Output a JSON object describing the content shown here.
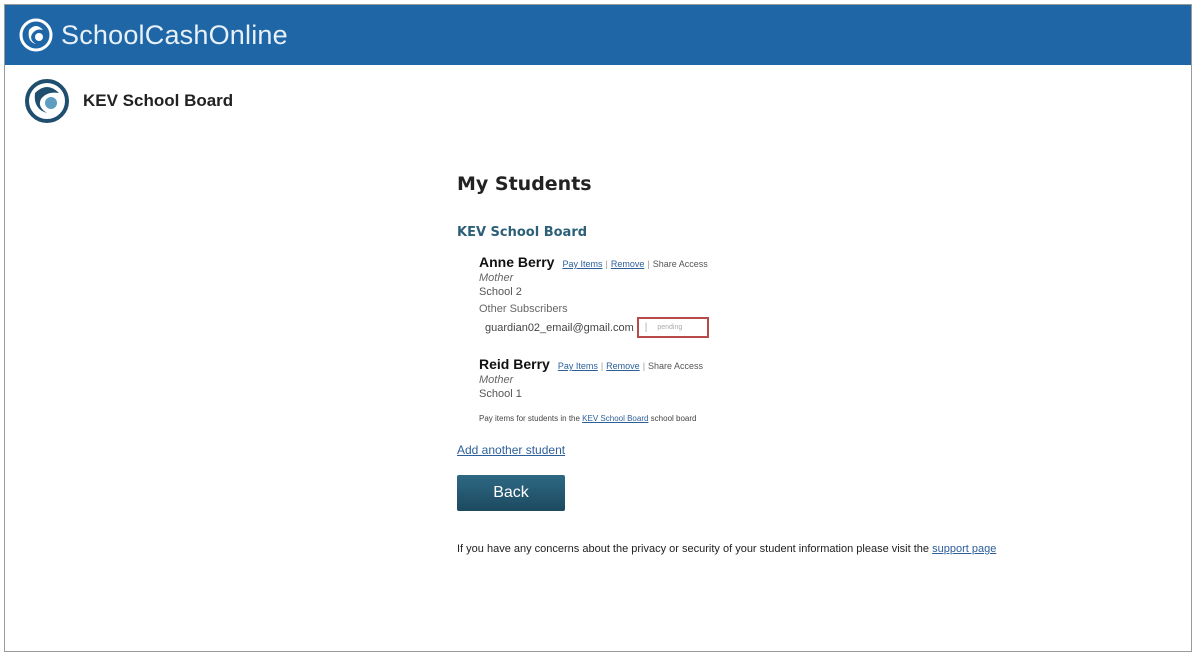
{
  "topbar": {
    "brand": "SchoolCashOnline",
    "bg_color": "#1f66a6"
  },
  "board_header": {
    "name": "KEV School Board"
  },
  "main": {
    "title": "My Students",
    "school_board": "KEV School Board",
    "students": [
      {
        "name": "Anne Berry",
        "actions": {
          "pay_items": "Pay Items",
          "remove": "Remove",
          "share": "Share Access"
        },
        "relation": "Mother",
        "school": "School 2",
        "other_subscribers_label": "Other Subscribers",
        "subscriber_email": "guardian02_email@gmail.com",
        "subscriber_status": "pending"
      },
      {
        "name": "Reid Berry",
        "actions": {
          "pay_items": "Pay Items",
          "remove": "Remove",
          "share": "Share Access"
        },
        "relation": "Mother",
        "school": "School 1"
      }
    ],
    "board_note": {
      "prefix": "Pay items for students in the",
      "link": "KEV School Board",
      "suffix": "school board"
    },
    "add_student": "Add another student",
    "back_button": "Back",
    "privacy": {
      "text": "If you have any concerns about the privacy or security of your student information please visit the",
      "link": "support page"
    }
  },
  "colors": {
    "accent": "#2c5f78",
    "link": "#2c5f9a",
    "button": "#1c4a60",
    "highlight_box": "#b94a4a"
  }
}
